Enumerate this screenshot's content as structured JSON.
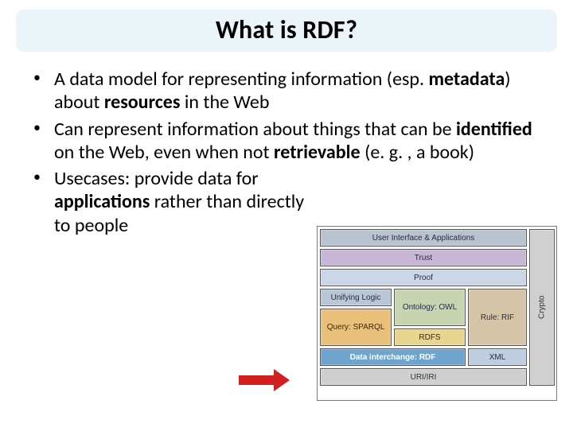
{
  "title": "What is RDF?",
  "bullets": [
    {
      "pre": "A data model for representing information (esp. ",
      "b1": "metadata",
      "mid1": ") about ",
      "b2": "resources",
      "post": " in the Web"
    },
    {
      "pre": "Can represent information about things that can be ",
      "b1": "identified",
      "mid1": " on the Web, even when not ",
      "b2": "retrievable",
      "post": " (e. g. , a book)"
    },
    {
      "pre": "Usecases: provide data for ",
      "b1": "applications",
      "mid1": " rather than directly to people",
      "b2": "",
      "post": ""
    }
  ],
  "stack": {
    "ui": "User Interface & Applications",
    "trust": "Trust",
    "proof": "Proof",
    "logic": "Unifying Logic",
    "owl": "Ontology: OWL",
    "rule": "Rule: RIF",
    "sparql": "Query: SPARQL",
    "rdfs": "RDFS",
    "rdf": "Data interchange: RDF",
    "xml": "XML",
    "uri": "URI/IRI",
    "crypto": "Crypto"
  }
}
